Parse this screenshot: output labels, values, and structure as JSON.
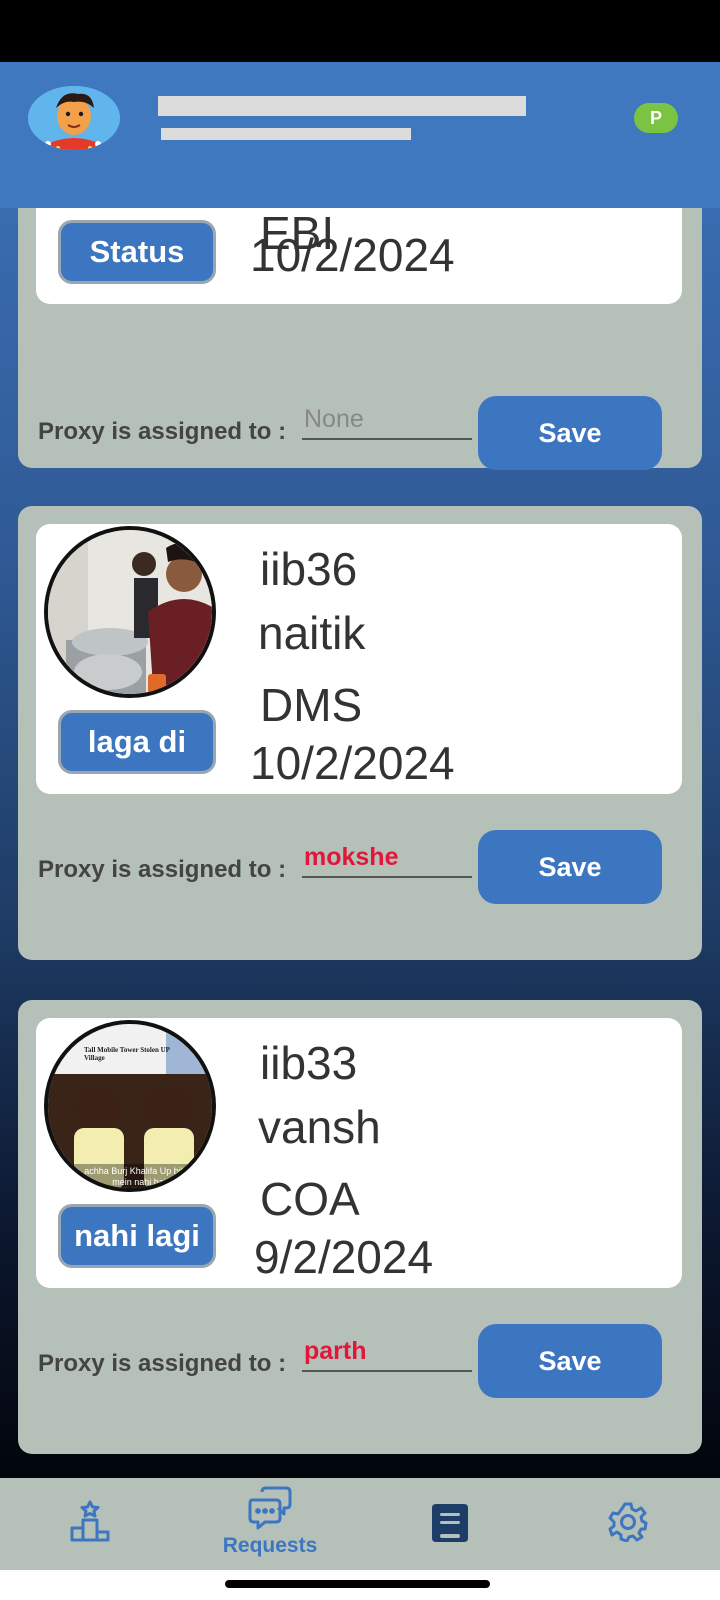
{
  "header": {
    "badge": "P"
  },
  "cards": [
    {
      "line_partial": "EBI",
      "date": "10/2/2024",
      "status_label": "Status",
      "proxy_label": "Proxy is assigned to :",
      "proxy_placeholder": "None",
      "proxy_value": "",
      "save_label": "Save"
    },
    {
      "code": "iib36",
      "name": "naitik",
      "subject": "DMS",
      "date": "10/2/2024",
      "status_label": "laga di",
      "proxy_label": "Proxy is assigned to :",
      "proxy_value": "mokshe",
      "save_label": "Save"
    },
    {
      "code": "iib33",
      "name": "vansh",
      "subject": "COA",
      "date": "9/2/2024",
      "status_label": "nahi lagi",
      "proxy_label": "Proxy is assigned to :",
      "proxy_value": "parth",
      "save_label": "Save",
      "meme_caption_top": "Tall Mobile Tower Stolen UP Village",
      "meme_caption_bottom": "achha Burj Khalifa Up bihar mein nahi hai"
    }
  ],
  "nav": {
    "items": [
      {
        "icon": "podium-icon",
        "label": ""
      },
      {
        "icon": "chat-bubbles-icon",
        "label": "Requests"
      },
      {
        "icon": "bookmark-list-icon",
        "label": ""
      },
      {
        "icon": "gear-icon",
        "label": ""
      }
    ]
  },
  "colors": {
    "accent": "#3d76c0",
    "card_bg": "#b5c0b9",
    "proxy_value": "#e2163a",
    "badge": "#7cc243"
  }
}
